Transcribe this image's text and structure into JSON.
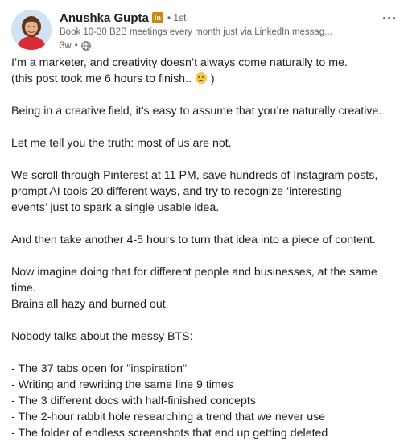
{
  "author": {
    "name": "Anushka Gupta",
    "badge": "in",
    "degree": "• 1st",
    "headline": "Book 10-30 B2B meetings every month just via LinkedIn messag...",
    "time": "3w",
    "time_separator": "•",
    "avatar_icon": "avatar-photo",
    "visibility_icon": "globe-icon"
  },
  "post": {
    "p1": "I’m a marketer, and creativity doesn’t always come naturally to me.",
    "p2a": "(this post took me 6 hours to finish..",
    "p2b": ")",
    "p2_emoji": "melting-face-emoji",
    "p3": "Being in a creative field, it’s easy to assume that you’re naturally creative.",
    "p4": "Let me tell you the truth: most of us are not.",
    "p5": "We scroll through Pinterest at 11 PM, save hundreds of Instagram posts,",
    "p6": "prompt AI tools 20 different ways, and try to recognize ‘interesting",
    "p7": "events’ just to spark a single usable idea.",
    "p8": "And then take another 4-5 hours to turn that idea into a piece of content.",
    "p9": "Now imagine doing that for different people and businesses, at the same",
    "p10": "time.",
    "p11": "Brains all hazy and burned out.",
    "p12": "Nobody talks about the messy BTS:",
    "bullets": [
      "- The 37 tabs open for \"inspiration\"",
      "- Writing and rewriting the same line 9 times",
      "- The 3 different docs with half-finished concepts",
      "- The 2-hour rabbit hole researching a trend that we never use",
      "- The folder of endless screenshots that end up getting deleted"
    ]
  },
  "colors": {
    "text": "#1f1f1f",
    "muted": "#666666",
    "badge": "#c38a24"
  }
}
